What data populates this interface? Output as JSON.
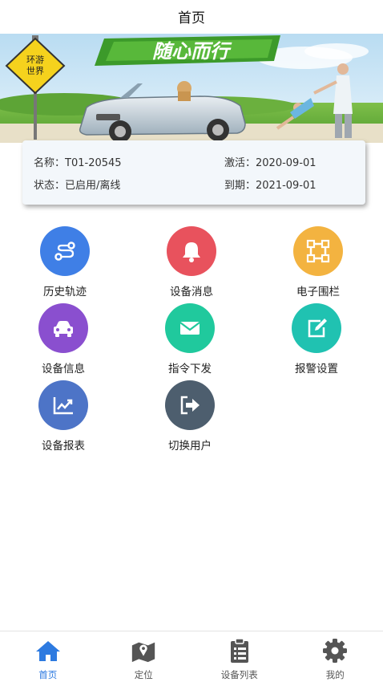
{
  "header": {
    "title": "首页"
  },
  "banner": {
    "sign_text_line1": "环游",
    "sign_text_line2": "世界",
    "slogan": "随心而行"
  },
  "device": {
    "name_label": "名称：",
    "name_value": "T01-20545",
    "status_label": "状态：",
    "status_value": "已启用/离线",
    "activate_label": "激活：",
    "activate_value": "2020-09-01",
    "expire_label": "到期：",
    "expire_value": "2021-09-01"
  },
  "menu": [
    {
      "label": "历史轨迹",
      "icon": "route-icon",
      "color": "#3f7fe6"
    },
    {
      "label": "设备消息",
      "icon": "bell-icon",
      "color": "#e8525d"
    },
    {
      "label": "电子围栏",
      "icon": "fence-icon",
      "color": "#f3b340"
    },
    {
      "label": "设备信息",
      "icon": "car-icon",
      "color": "#8a4fcf"
    },
    {
      "label": "指令下发",
      "icon": "envelope-icon",
      "color": "#20c99d"
    },
    {
      "label": "报警设置",
      "icon": "edit-icon",
      "color": "#20c2b1"
    },
    {
      "label": "设备报表",
      "icon": "chart-icon",
      "color": "#4d74c7"
    },
    {
      "label": "切换用户",
      "icon": "switch-user-icon",
      "color": "#4d5e6e"
    }
  ],
  "bottom_nav": [
    {
      "label": "首页",
      "icon": "home-icon",
      "active": true
    },
    {
      "label": "定位",
      "icon": "map-icon",
      "active": false
    },
    {
      "label": "设备列表",
      "icon": "clipboard-list-icon",
      "active": false
    },
    {
      "label": "我的",
      "icon": "gear-icon",
      "active": false
    }
  ],
  "colors": {
    "accent": "#2d7ae0",
    "inactive_nav": "#555555"
  }
}
